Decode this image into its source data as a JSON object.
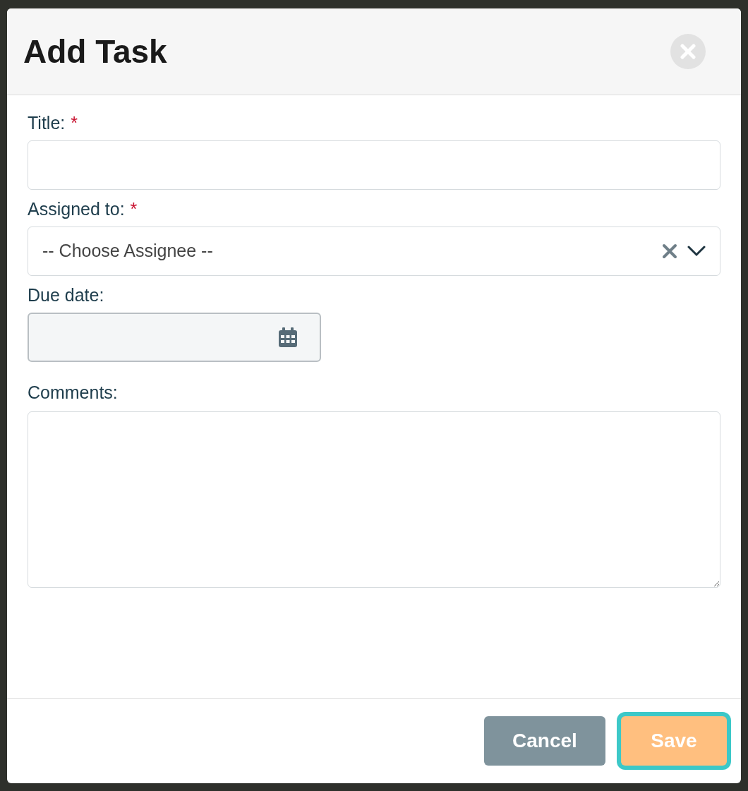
{
  "dialog": {
    "title": "Add Task"
  },
  "fields": [
    {
      "kind": "text",
      "label": "Title:",
      "required_mark": "*"
    },
    {
      "kind": "select",
      "label": "Assigned to:",
      "required_mark": "*",
      "placeholder": "-- Choose Assignee --"
    },
    {
      "kind": "date",
      "label": "Due date:"
    },
    {
      "kind": "textarea",
      "label": "Comments:"
    }
  ],
  "buttons": [
    {
      "label": "Cancel",
      "kind": "secondary",
      "focused": false
    },
    {
      "label": "Save",
      "kind": "primary",
      "focused": true
    }
  ]
}
